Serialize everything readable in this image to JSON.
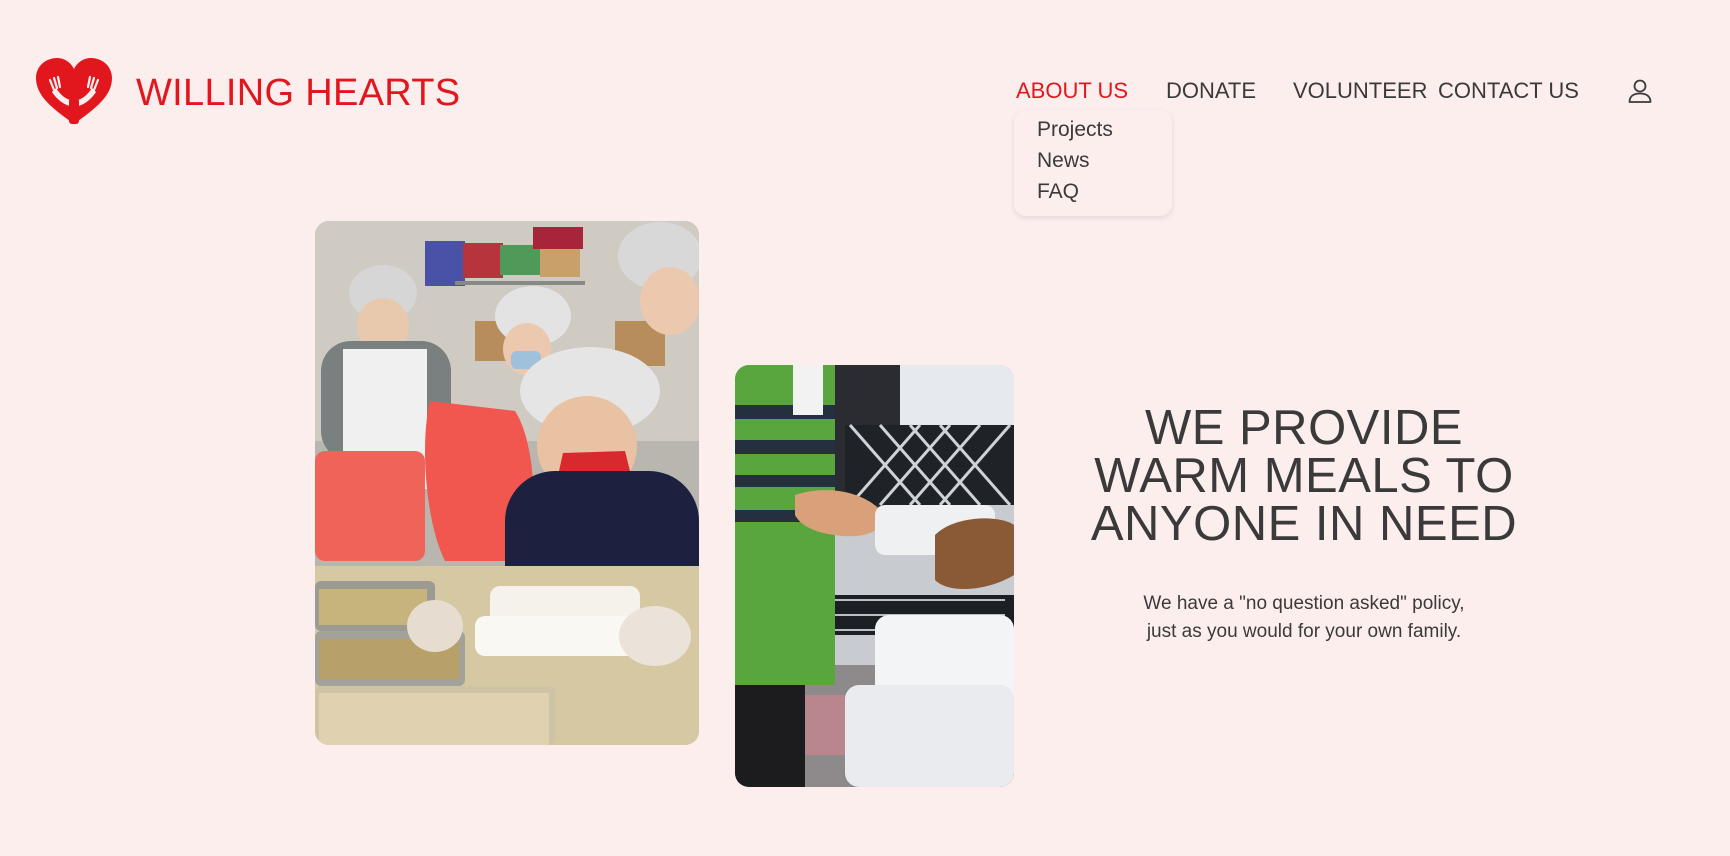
{
  "brand": {
    "name": "WILLING HEARTS",
    "logo_icon": "heart-hands-icon",
    "color": "#e2171e"
  },
  "nav": {
    "items": [
      {
        "label": "ABOUT US",
        "active": true
      },
      {
        "label": "DONATE",
        "active": false
      },
      {
        "label": "VOLUNTEER",
        "active": false
      },
      {
        "label": "CONTACT US",
        "active": false
      }
    ],
    "user_icon": "user-icon",
    "dropdown": {
      "parent": "ABOUT US",
      "items": [
        "Projects",
        "News",
        "FAQ"
      ]
    }
  },
  "hero": {
    "heading_lines": [
      "WE PROVIDE",
      "WARM MEALS TO",
      "ANYONE IN NEED"
    ],
    "body_lines": [
      "We have a \"no question asked\" policy,",
      "just as you would for your own family."
    ]
  },
  "colors": {
    "background": "#fdeeee",
    "accent": "#e2171e",
    "text": "#3a3a3a"
  }
}
